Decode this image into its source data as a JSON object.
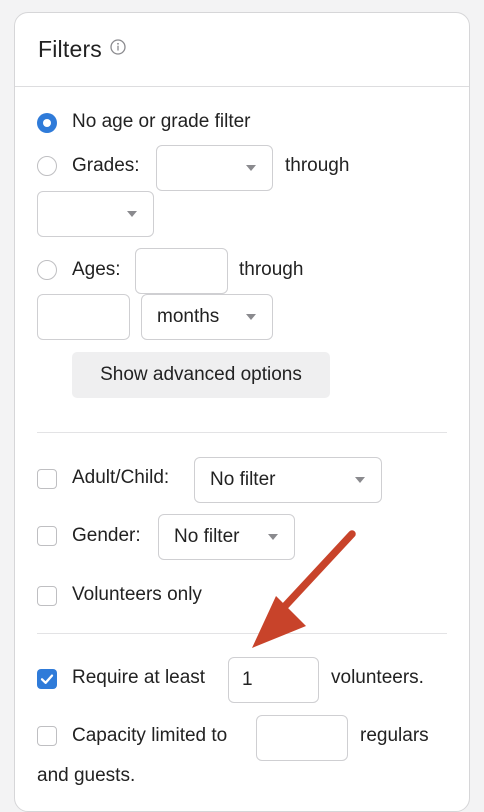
{
  "panel": {
    "title": "Filters",
    "info_icon": "info-circle-icon"
  },
  "age_grade": {
    "no_filter_label": "No age or grade filter",
    "no_filter_selected": true,
    "grades_label": "Grades:",
    "grades_from": "",
    "grades_through_label": "through",
    "grades_to": "",
    "ages_label": "Ages:",
    "ages_from": "",
    "ages_through_label": "through",
    "ages_to": "",
    "ages_unit": "months",
    "advanced_button": "Show advanced options"
  },
  "demographics": {
    "adult_child_label": "Adult/Child:",
    "adult_child_value": "No filter",
    "gender_label": "Gender:",
    "gender_value": "No filter",
    "volunteers_only_label": "Volunteers only"
  },
  "requirements": {
    "require_label": "Require at least",
    "require_checked": true,
    "require_value": "1",
    "require_suffix": "volunteers.",
    "capacity_label": "Capacity limited to",
    "capacity_value": "",
    "capacity_suffix": "regulars",
    "capacity_suffix_2": "and guests."
  },
  "colors": {
    "accent": "#2f7bd9",
    "arrow": "#c8432a"
  }
}
